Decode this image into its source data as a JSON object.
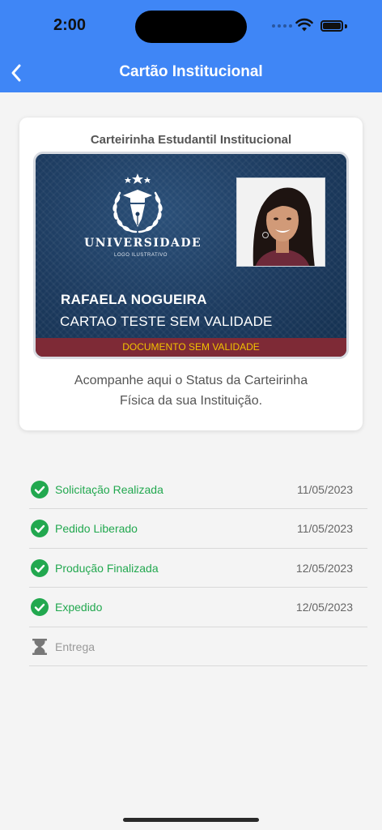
{
  "status_bar": {
    "time": "2:00"
  },
  "nav": {
    "title": "Cartão Institucional",
    "back_icon": "chevron-left-icon"
  },
  "card": {
    "title": "Carteirinha Estudantil Institucional",
    "id_card": {
      "institution": "UNIVERSIDADE",
      "institution_sub": "LOGO ILUSTRATIVO",
      "holder_name": "RAFAELA NOGUEIRA",
      "holder_sub": "CARTAO TESTE SEM VALIDADE",
      "validity_note": "DOCUMENTO SEM VALIDADE"
    },
    "description_line1": "Acompanhe aqui o Status da Carteirinha",
    "description_line2": "Física da sua Instituição."
  },
  "timeline": [
    {
      "label": "Solicitação Realizada",
      "date": "11/05/2023",
      "status": "done",
      "icon": "check-circle-icon"
    },
    {
      "label": "Pedido Liberado",
      "date": "11/05/2023",
      "status": "done",
      "icon": "check-circle-icon"
    },
    {
      "label": "Produção Finalizada",
      "date": "12/05/2023",
      "status": "done",
      "icon": "check-circle-icon"
    },
    {
      "label": "Expedido",
      "date": "12/05/2023",
      "status": "done",
      "icon": "check-circle-icon"
    },
    {
      "label": "Entrega",
      "date": "",
      "status": "pending",
      "icon": "hourglass-icon"
    }
  ],
  "colors": {
    "accent": "#3f86f6",
    "success": "#22a84f",
    "pending": "#999999",
    "validity_bar": "#7e2a36"
  }
}
